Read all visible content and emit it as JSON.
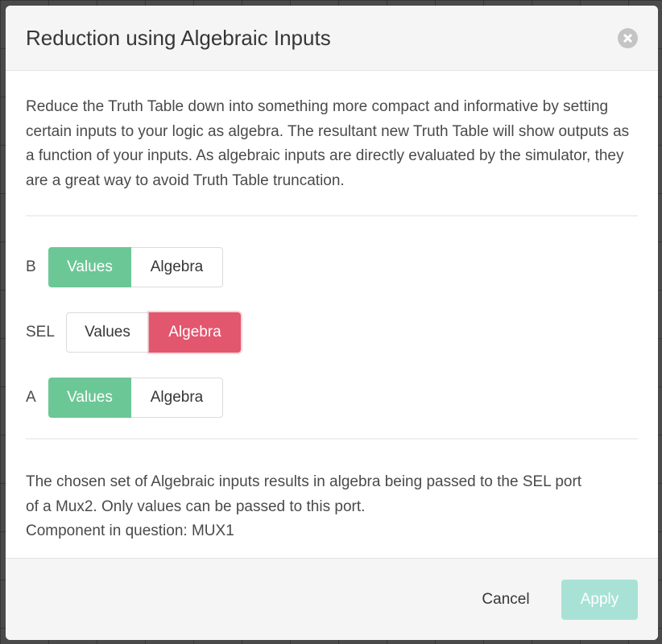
{
  "modal": {
    "title": "Reduction using Algebraic Inputs",
    "intro": "Reduce the Truth Table down into something more compact and informative by setting certain inputs to your logic as algebra. The resultant new Truth Table will show outputs as a function of your inputs. As algebraic inputs are directly evaluated by the simulator, they are a great way to avoid Truth Table truncation.",
    "inputs": [
      {
        "label": "B",
        "options": [
          "Values",
          "Algebra"
        ],
        "selected": "Values",
        "selected_color": "#6cc796"
      },
      {
        "label": "SEL",
        "options": [
          "Values",
          "Algebra"
        ],
        "selected": "Algebra",
        "selected_color": "#e2566e"
      },
      {
        "label": "A",
        "options": [
          "Values",
          "Algebra"
        ],
        "selected": "Values",
        "selected_color": "#6cc796"
      }
    ],
    "message_lines": [
      "The chosen set of Algebraic inputs results in algebra being passed to the SEL port",
      "of a Mux2. Only values can be passed to this port.",
      "Component in question: MUX1"
    ],
    "footer": {
      "cancel_label": "Cancel",
      "apply_label": "Apply",
      "apply_enabled": false
    }
  },
  "icons": {
    "close": "close-icon"
  },
  "colors": {
    "values_active": "#6cc796",
    "algebra_active": "#e2566e",
    "apply_disabled": "#a8e2d6"
  }
}
